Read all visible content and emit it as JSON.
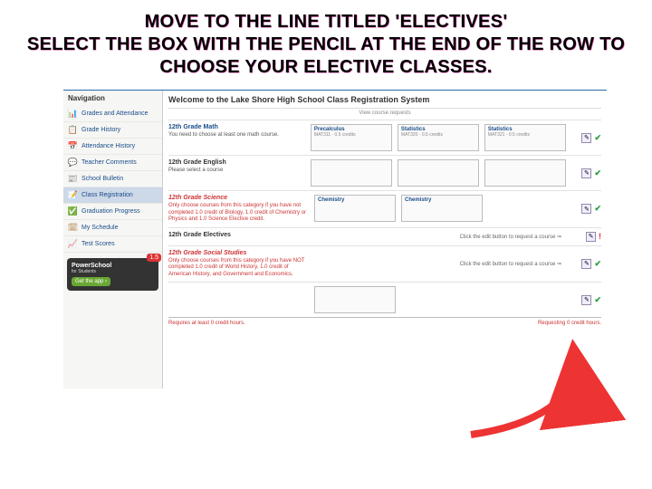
{
  "heading_line1": "MOVE TO THE LINE TITLED 'ELECTIVES'",
  "heading_line2": "SELECT THE BOX WITH THE PENCIL AT THE END OF THE ROW TO CHOOSE YOUR ELECTIVE CLASSES.",
  "sidebar": {
    "title": "Navigation",
    "items": [
      {
        "label": "Grades and Attendance",
        "icon": "📊"
      },
      {
        "label": "Grade History",
        "icon": "📋"
      },
      {
        "label": "Attendance History",
        "icon": "📅"
      },
      {
        "label": "Teacher Comments",
        "icon": "💬"
      },
      {
        "label": "School Bulletin",
        "icon": "📰"
      },
      {
        "label": "Class Registration",
        "icon": "📝"
      },
      {
        "label": "Graduation Progress",
        "icon": "✅"
      },
      {
        "label": "My Schedule",
        "icon": "🗓"
      },
      {
        "label": "Test Scores",
        "icon": "📈"
      }
    ],
    "promo": {
      "brand": "PowerSchool",
      "sub": "for Students",
      "badge": "1.5",
      "btn": "Get the app ›"
    }
  },
  "main": {
    "welcome": "Welcome to the Lake Shore High School Class Registration System",
    "subwelcome": "View course requests",
    "rows": [
      {
        "title": "12th Grade Math",
        "title_class": "",
        "body": "You need to choose at least one math course.",
        "slots": [
          {
            "t": "Precalculus",
            "s": "MAT311 - 0.5 credits"
          },
          {
            "t": "Statistics",
            "s": "MAT320 - 0.5 credits"
          },
          {
            "t": "Statistics",
            "s": "MAT321 - 0.5 credits"
          }
        ],
        "actions": "edit-check"
      },
      {
        "title": "12th Grade English",
        "title_class": "plain",
        "body": "Please select a course",
        "slots": [
          {
            "t": "",
            "s": ""
          },
          {
            "t": "",
            "s": ""
          },
          {
            "t": "",
            "s": ""
          }
        ],
        "actions": "edit-check"
      },
      {
        "title": "12th Grade Science",
        "title_class": "red",
        "body_class": "red",
        "body": "Only choose courses from this category if you have not completed 1.0 credit of Biology, 1.0 credit of Chemistry or Physics and 1.0 Science Elective credit.",
        "slots": [
          {
            "t": "Chemistry",
            "s": ""
          },
          {
            "t": "Chemistry",
            "s": ""
          }
        ],
        "actions": "edit-check"
      },
      {
        "title": "12th Grade Electives",
        "title_class": "plain",
        "body": "",
        "hint": "Click the edit button to request a course ⇒",
        "actions": "edit-warn"
      },
      {
        "title": "12th Grade Social Studies",
        "title_class": "red",
        "body_class": "red",
        "body": "Only choose courses from this category if you have NOT completed 1.0 credit of World History, 1.0 credit of American History, and Government and Economics.",
        "hint": "Click the edit button to request a course ⇒",
        "actions": "edit-check"
      },
      {
        "title": "",
        "body": "",
        "slots": [
          {
            "t": "",
            "s": ""
          }
        ],
        "actions": "edit-check"
      }
    ],
    "req_left": "Requires at least 0 credit hours.",
    "req_right": "Requesting 0 credit hours."
  }
}
